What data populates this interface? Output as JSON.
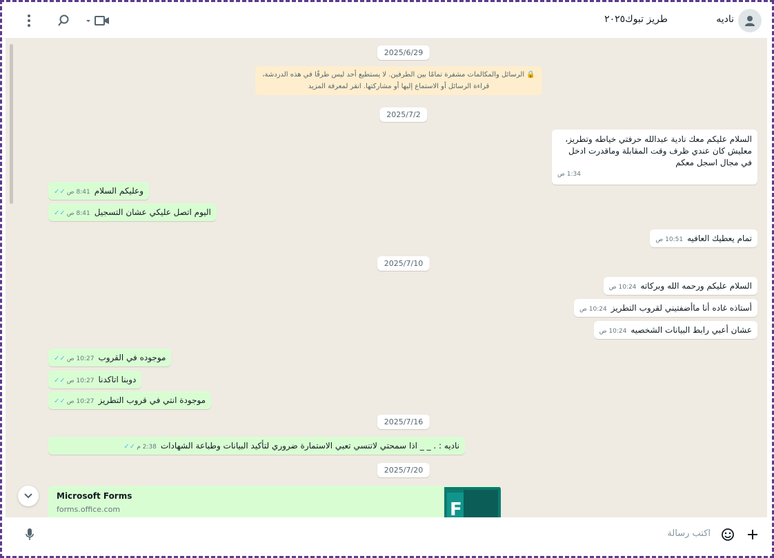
{
  "header": {
    "contact_name": "ناديه",
    "group_name": "طريز تبوك٢٠٢٥",
    "icons": [
      "menu-icon",
      "search-icon",
      "video-call-icon",
      "avatar-icon"
    ]
  },
  "dates": [
    "2025/6/29",
    "2025/7/2",
    "2025/7/10",
    "2025/7/16",
    "2025/7/20"
  ],
  "notice": "🔒 الرسائل والمكالمات مشفرة تمامًا بين الطرفين. لا يستطيع أحد ليس طرفًا في هذه الدردشة، قراءة الرسائل أو الاستماع إليها أو مشاركتها. انقر لمعرفة المزيد",
  "messages": [
    {
      "text": "السلام عليكم معك نادية عبدالله حرفتي خياطه وتطريز، معليش كان عندي ظرف وقت المقابلة وماقدرت ادخل في مجال اسجل معكم",
      "time": "1:34 ص"
    },
    {
      "text": "وعليكم السلام",
      "time": "8:41 ص"
    },
    {
      "text": "اليوم اتصل عليكي عشان التسجيل",
      "time": "8:41 ص"
    },
    {
      "text": "تمام يعطيك العافيه",
      "time": "10:51 ص"
    },
    {
      "text": "السلام عليكم ورحمه الله وبركاته",
      "time": "10:24 ص"
    },
    {
      "text": "أستاذه غاده أنا ماأضفتيني لقروب التطريز",
      "time": "10:24 ص"
    },
    {
      "text": "عشان أعبي رابط البيانات الشخصيه",
      "time": "10:24 ص"
    },
    {
      "text": "موجوده في القروب",
      "time": "10:27 ص"
    },
    {
      "text": "دوبنا اتاكدنا",
      "time": "10:27 ص"
    },
    {
      "text": "موجودة انتي في قروب التطريز",
      "time": "10:27 ص"
    },
    {
      "text": "ناديه :                 .      _ _      اذا سمحتي لاتنسي تعبي الاستمارة ضروري لتأكيد البيانات وطباعة الشهادات",
      "time": "2:38 م"
    }
  ],
  "link_preview": {
    "title": "Microsoft Forms",
    "url": "forms.office.com"
  },
  "composer": {
    "placeholder": "اكتب رسالة"
  },
  "colors": {
    "outgoing": "#d9fdd3",
    "incoming": "#ffffff",
    "notice": "#ffeecd",
    "ticks": "#53bdeb",
    "frame": "#5b3b8c"
  }
}
